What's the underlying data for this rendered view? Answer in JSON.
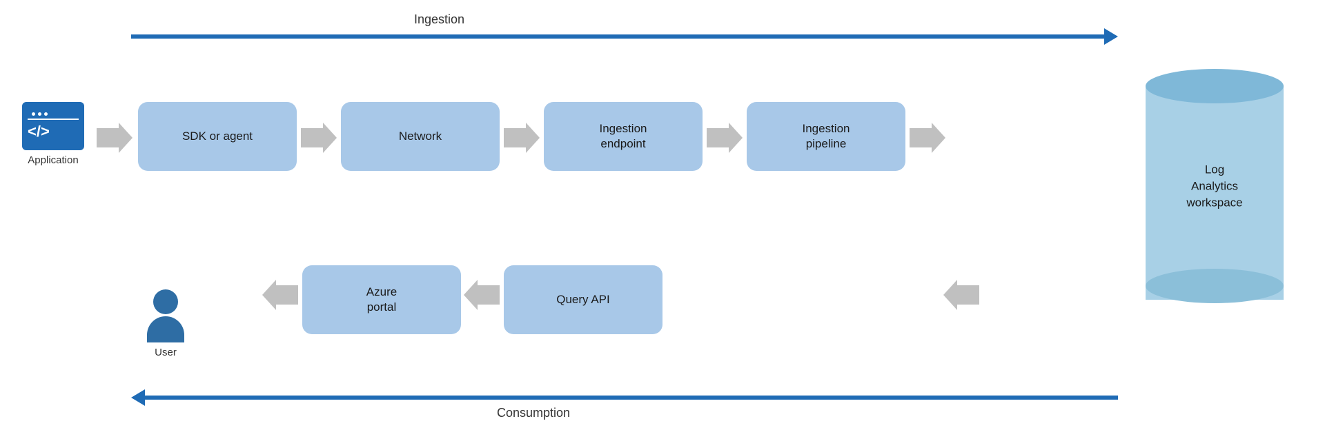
{
  "diagram": {
    "ingestion_label": "Ingestion",
    "consumption_label": "Consumption",
    "application_label": "Application",
    "user_label": "User",
    "log_analytics_label": "Log Analytics\nworkspace",
    "flow_boxes_top": [
      {
        "id": "sdk",
        "label": "SDK or agent"
      },
      {
        "id": "network",
        "label": "Network"
      },
      {
        "id": "endpoint",
        "label": "Ingestion\nendpoint"
      },
      {
        "id": "pipeline",
        "label": "Ingestion\npipeline"
      }
    ],
    "flow_boxes_bottom": [
      {
        "id": "azure_portal",
        "label": "Azure\nportal"
      },
      {
        "id": "query_api",
        "label": "Query API"
      }
    ]
  }
}
